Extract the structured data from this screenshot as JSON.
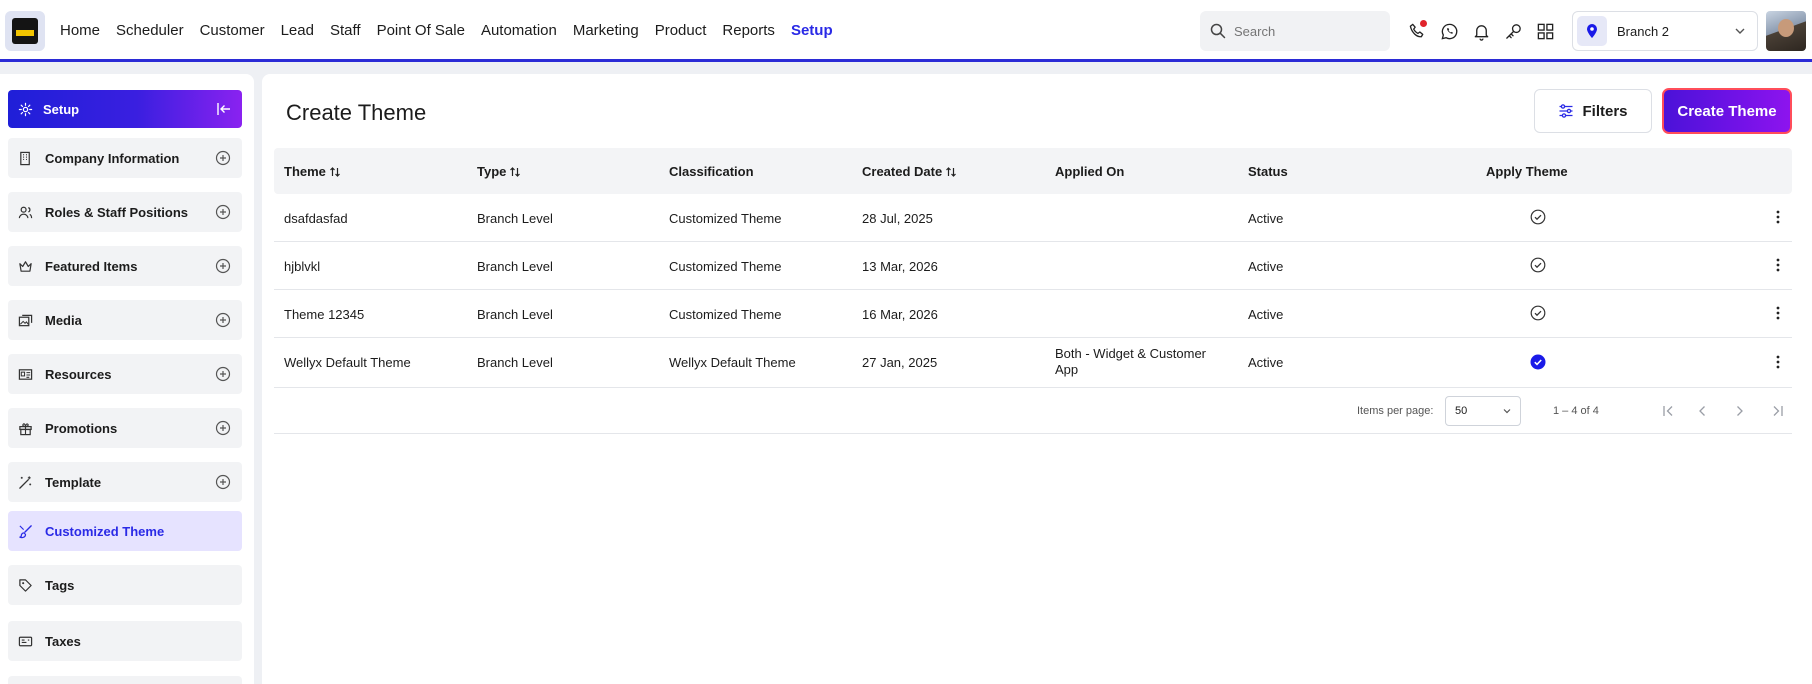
{
  "nav": {
    "items": [
      "Home",
      "Scheduler",
      "Customer",
      "Lead",
      "Staff",
      "Point Of Sale",
      "Automation",
      "Marketing",
      "Product",
      "Reports",
      "Setup"
    ],
    "active": "Setup"
  },
  "search": {
    "placeholder": "Search"
  },
  "top_icons": [
    "phone-icon",
    "whatsapp-icon",
    "bell-icon",
    "key-icon",
    "apps-grid-icon"
  ],
  "branch": {
    "label": "Branch 2"
  },
  "sidebar": {
    "header": "Setup",
    "items": [
      {
        "label": "Company Information",
        "icon": "building-icon",
        "expandable": true
      },
      {
        "label": "Roles & Staff Positions",
        "icon": "users-icon",
        "expandable": true
      },
      {
        "label": "Featured Items",
        "icon": "crown-icon",
        "expandable": true
      },
      {
        "label": "Media",
        "icon": "images-icon",
        "expandable": true
      },
      {
        "label": "Resources",
        "icon": "id-card-icon",
        "expandable": true
      },
      {
        "label": "Promotions",
        "icon": "gift-icon",
        "expandable": true
      },
      {
        "label": "Template",
        "icon": "magic-wand-icon",
        "expandable": true
      },
      {
        "label": "Customized Theme",
        "icon": "brush-icon",
        "expandable": false,
        "active": true
      },
      {
        "label": "Tags",
        "icon": "tag-icon",
        "expandable": false
      },
      {
        "label": "Taxes",
        "icon": "receipt-icon",
        "expandable": false
      }
    ]
  },
  "page": {
    "title": "Create Theme",
    "filters_label": "Filters",
    "create_label": "Create Theme"
  },
  "table": {
    "columns": [
      "Theme",
      "Type",
      "Classification",
      "Created Date",
      "Applied On",
      "Status",
      "Apply Theme"
    ],
    "rows": [
      {
        "theme": "dsafdasfad",
        "type": "Branch Level",
        "classification": "Customized Theme",
        "created": "28 Jul, 2025",
        "applied_on": "",
        "status": "Active",
        "applied": false
      },
      {
        "theme": "hjblvkl",
        "type": "Branch Level",
        "classification": "Customized Theme",
        "created": "13 Mar, 2026",
        "applied_on": "",
        "status": "Active",
        "applied": false
      },
      {
        "theme": "Theme 12345",
        "type": "Branch Level",
        "classification": "Customized Theme",
        "created": "16 Mar, 2026",
        "applied_on": "",
        "status": "Active",
        "applied": false
      },
      {
        "theme": "Wellyx Default Theme",
        "type": "Branch Level",
        "classification": "Wellyx Default Theme",
        "created": "27 Jan, 2025",
        "applied_on": "Both - Widget & Customer App",
        "status": "Active",
        "applied": true
      }
    ]
  },
  "pagination": {
    "items_per_page_label": "Items per page:",
    "items_per_page": "50",
    "range": "1 – 4 of 4"
  },
  "colors": {
    "accent": "#2a2ae6",
    "gradient_start": "#1f1fd8",
    "gradient_end": "#8d14ee",
    "applied_check": "#1a1ae8"
  }
}
